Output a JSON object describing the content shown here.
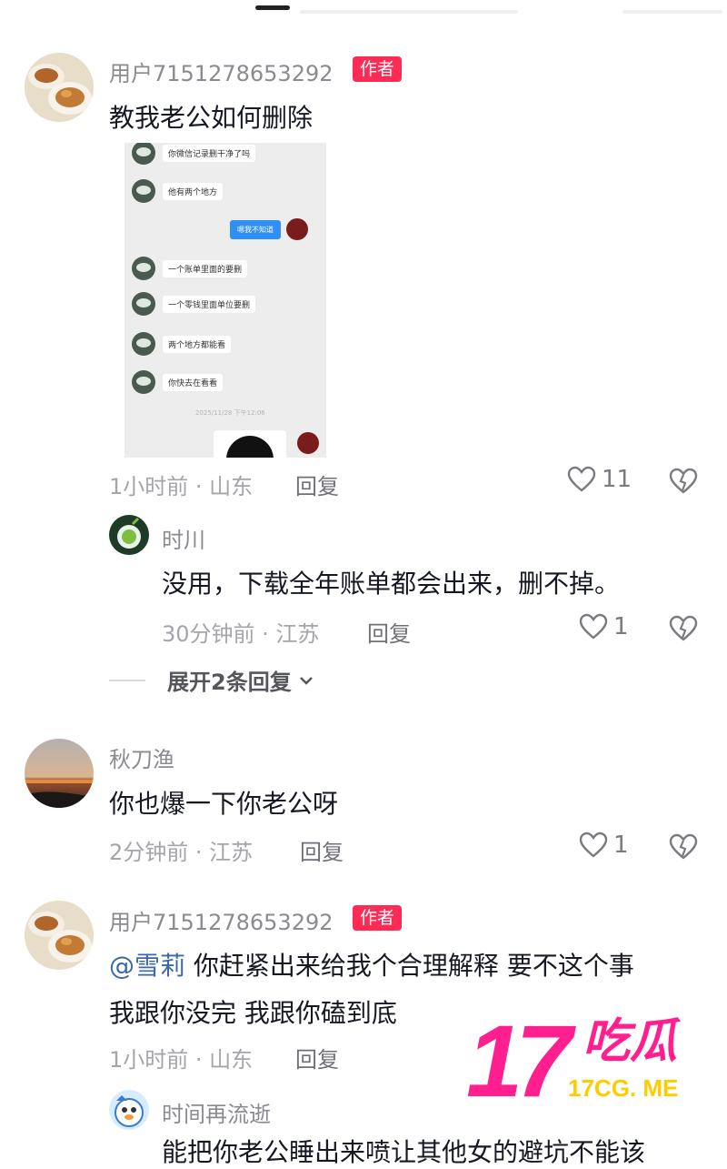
{
  "comments": [
    {
      "user": "用户7151278653292",
      "author_tag": "作者",
      "text": "教我老公如何删除",
      "screenshot": {
        "messages": [
          "你微信记录删干净了吗",
          "他有两个地方",
          "一个账单里面的要删",
          "一个零钱里面单位要删",
          "两个地方都能看",
          "你快去在看看"
        ],
        "reply_bubble": "嗯我不知道",
        "timestamp": "2025/11/28 下午12:06"
      },
      "meta": "1小时前 · 山东",
      "reply_label": "回复",
      "likes": "11",
      "replies": [
        {
          "user": "时川",
          "text": "没用，下载全年账单都会出来，删不掉。",
          "meta": "30分钟前 · 江苏",
          "reply_label": "回复",
          "likes": "1"
        }
      ],
      "expand_label": "展开2条回复"
    },
    {
      "user": "秋刀渔",
      "text": "你也爆一下你老公呀",
      "meta": "2分钟前 · 江苏",
      "reply_label": "回复",
      "likes": "1"
    },
    {
      "user": "用户7151278653292",
      "author_tag": "作者",
      "mention": "@雪莉",
      "text_line1": "你赶紧出来给我个合理解释 要不这个事",
      "text_line2": "我跟你没完 我跟你磕到底",
      "meta": "1小时前 · 山东",
      "reply_label": "回复",
      "replies": [
        {
          "user": "时间再流逝",
          "text": "能把你老公睡出来喷让其他女的避坑不能该"
        }
      ]
    }
  ],
  "watermark": {
    "number": "17",
    "chinese": "吃瓜",
    "domain": "17CG. ME"
  },
  "colors": {
    "author_tag": "#fe2c55",
    "mention": "#3a68a8",
    "watermark_pink": "#ff1f8e",
    "watermark_yellow": "#ffcc00"
  }
}
